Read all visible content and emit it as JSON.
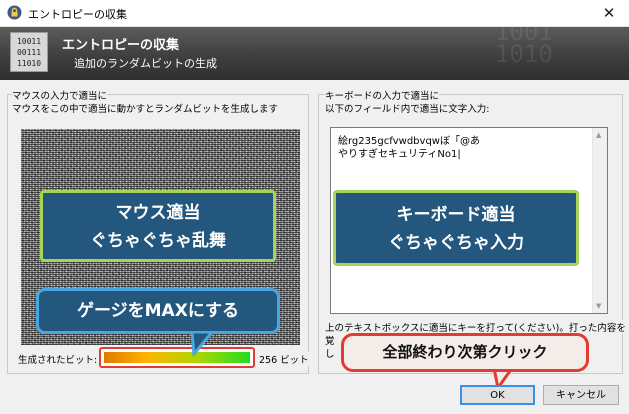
{
  "window": {
    "title": "エントロピーの収集",
    "close_glyph": "✕",
    "title_icon": "lock-icon"
  },
  "banner": {
    "icon_digits": [
      "10011",
      "00111",
      "11010"
    ],
    "title": "エントロピーの収集",
    "subtitle": "追加のランダムビットの生成",
    "bg_digits": "1001\n1010"
  },
  "mouse_group": {
    "label": "マウスの入力で適当に",
    "description": "マウスをこの中で適当に動かすとランダムビットを生成します"
  },
  "keyboard_group": {
    "label": "キーボードの入力で適当に",
    "description": "以下のフィールド内で適当に文字入力:",
    "text_lines": [
      "絵rg235gcfvwdbvqwぼ「@あ",
      "やりすぎセキュリティNo1|"
    ],
    "note_line1": "上のテキストボックスに適当にキーを打って(ください)。打った内容を",
    "note_line2_prefix": "覚",
    "note_line3_prefix": "し"
  },
  "gauge": {
    "label": "生成されたビット:",
    "value_text": "256 ビット",
    "fill_percent": 100
  },
  "buttons": {
    "ok": "OK",
    "cancel": "キャンセル"
  },
  "annotations": {
    "mouse_callout": [
      "マウス適当",
      "ぐちゃぐちゃ乱舞"
    ],
    "keyboard_callout": [
      "キーボード適当",
      "ぐちゃぐちゃ入力"
    ],
    "gauge_callout": "ゲージをMAXにする",
    "finish_callout": "全部終わり次第クリック"
  },
  "colors": {
    "callout_fill": "#24577e",
    "callout_green_border": "#a9d356",
    "callout_blue_border": "#49a6e0",
    "highlight_red": "#e33c2e",
    "ok_border": "#3a8ee6"
  }
}
